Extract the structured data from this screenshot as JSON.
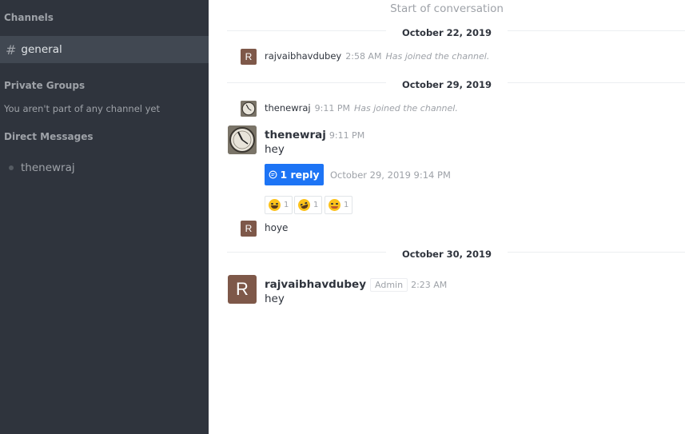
{
  "sidebar": {
    "channels_title": "Channels",
    "channels": [
      {
        "hash": "#",
        "name": "general"
      }
    ],
    "private_title": "Private Groups",
    "private_empty": "You aren't part of any channel yet",
    "dm_title": "Direct Messages",
    "dms": [
      {
        "name": "thenewraj"
      }
    ]
  },
  "conversation": {
    "start_label": "Start of conversation",
    "dates": [
      "October 22, 2019",
      "October 29, 2019",
      "October 30, 2019"
    ],
    "sys1": {
      "avatar": "R",
      "user": "rajvaibhavdubey",
      "time": "2:58 AM",
      "text": "Has joined the channel."
    },
    "sys2": {
      "user": "thenewraj",
      "time": "9:11 PM",
      "text": "Has joined the channel."
    },
    "msg1": {
      "user": "thenewraj",
      "time": "9:11 PM",
      "text": "hey",
      "reply_icon": "thread-icon",
      "reply_label": "1 reply",
      "reply_time": "October 29, 2019 9:14 PM",
      "reactions": [
        {
          "icon": "grinning-sweat-emoji",
          "count": "1"
        },
        {
          "icon": "rofl-emoji",
          "count": "1"
        },
        {
          "icon": "blush-emoji",
          "count": "1"
        }
      ]
    },
    "msg2": {
      "avatar": "R",
      "text": "hoye"
    },
    "msg3": {
      "avatar": "R",
      "user": "rajvaibhavdubey",
      "role": "Admin",
      "time": "2:23 AM",
      "text": "hey"
    }
  },
  "colors": {
    "sidebar": "#2f343d",
    "active_channel": "#414852",
    "accent": "#1d74f5",
    "avatar": "#7e5849"
  }
}
